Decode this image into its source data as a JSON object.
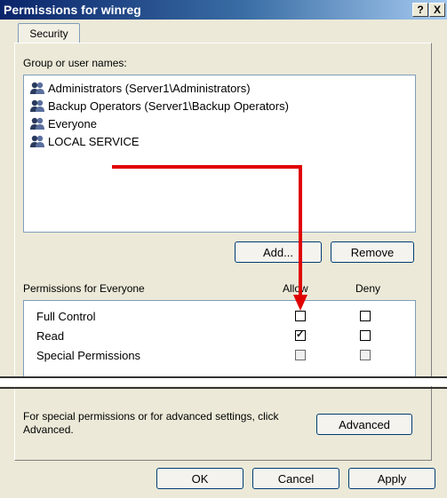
{
  "window": {
    "title": "Permissions for winreg",
    "help_label": "?",
    "close_label": "X"
  },
  "tabs": [
    {
      "label": "Security"
    }
  ],
  "group_label": "Group or user names:",
  "users": [
    {
      "label": "Administrators (Server1\\Administrators)"
    },
    {
      "label": "Backup Operators (Server1\\Backup Operators)"
    },
    {
      "label": "Everyone"
    },
    {
      "label": "LOCAL SERVICE"
    }
  ],
  "buttons": {
    "add": "Add...",
    "remove": "Remove",
    "advanced": "Advanced",
    "ok": "OK",
    "cancel": "Cancel",
    "apply": "Apply"
  },
  "permissions": {
    "label": "Permissions for Everyone",
    "allow_header": "Allow",
    "deny_header": "Deny",
    "rows": [
      {
        "label": "Full Control",
        "allow": false,
        "deny": false
      },
      {
        "label": "Read",
        "allow": true,
        "deny": false
      },
      {
        "label": "Special Permissions",
        "allow": false,
        "deny": false
      }
    ]
  },
  "advanced_text": "For special permissions or for advanced settings, click Advanced.",
  "icons": {
    "user_group": "user-group-icon"
  },
  "colors": {
    "title_bar": "#0a246a",
    "annotation_arrow": "#e00000"
  }
}
